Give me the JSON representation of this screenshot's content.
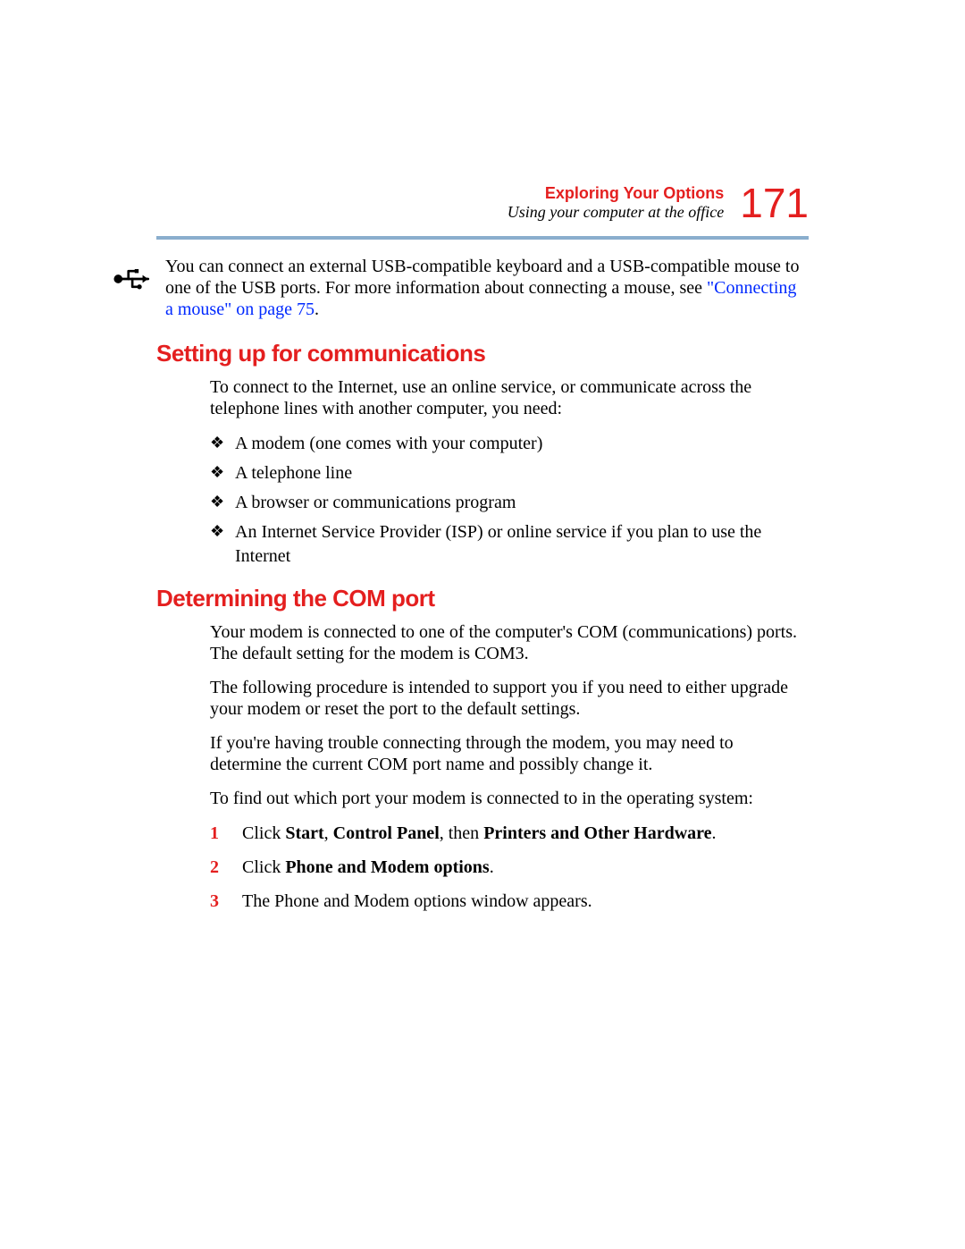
{
  "header": {
    "chapter": "Exploring Your Options",
    "section": "Using your computer at the office",
    "page_number": "171"
  },
  "icons": {
    "usb": "usb-icon"
  },
  "usb_paragraph": {
    "before_link": "You can connect an external USB-compatible keyboard and a USB-compatible mouse to one of the USB ports. For more information about connecting a mouse, see ",
    "link_text": "\"Connecting a mouse\" on page 75",
    "after_link": "."
  },
  "heading1": "Setting up for communications",
  "comm_intro": "To connect to the Internet, use an online service, or communicate across the telephone lines with another computer, you need:",
  "bullets": [
    "A modem (one comes with your computer)",
    "A telephone line",
    "A browser or communications program",
    "An Internet Service Provider (ISP) or online service if you plan to use the Internet"
  ],
  "heading2": "Determining the COM port",
  "com_p1": "Your modem is connected to one of the computer's COM (communications) ports. The default setting for the modem is COM3.",
  "com_p2": "The following procedure is intended to support you if you need to either upgrade your modem or reset the port to the default settings.",
  "com_p3": "If you're having trouble connecting through the modem, you may need to determine the current COM port name and possibly change it.",
  "com_p4": "To find out which port your modem is connected to in the operating system:",
  "steps": {
    "1": {
      "pre": "Click ",
      "b1": "Start",
      "mid1": ", ",
      "b2": "Control Panel",
      "mid2": ", then ",
      "b3": "Printers and Other Hardware",
      "post": "."
    },
    "2": {
      "pre": "Click ",
      "b1": "Phone and Modem options",
      "post": "."
    },
    "3": {
      "text": "The Phone and Modem options window appears."
    }
  }
}
